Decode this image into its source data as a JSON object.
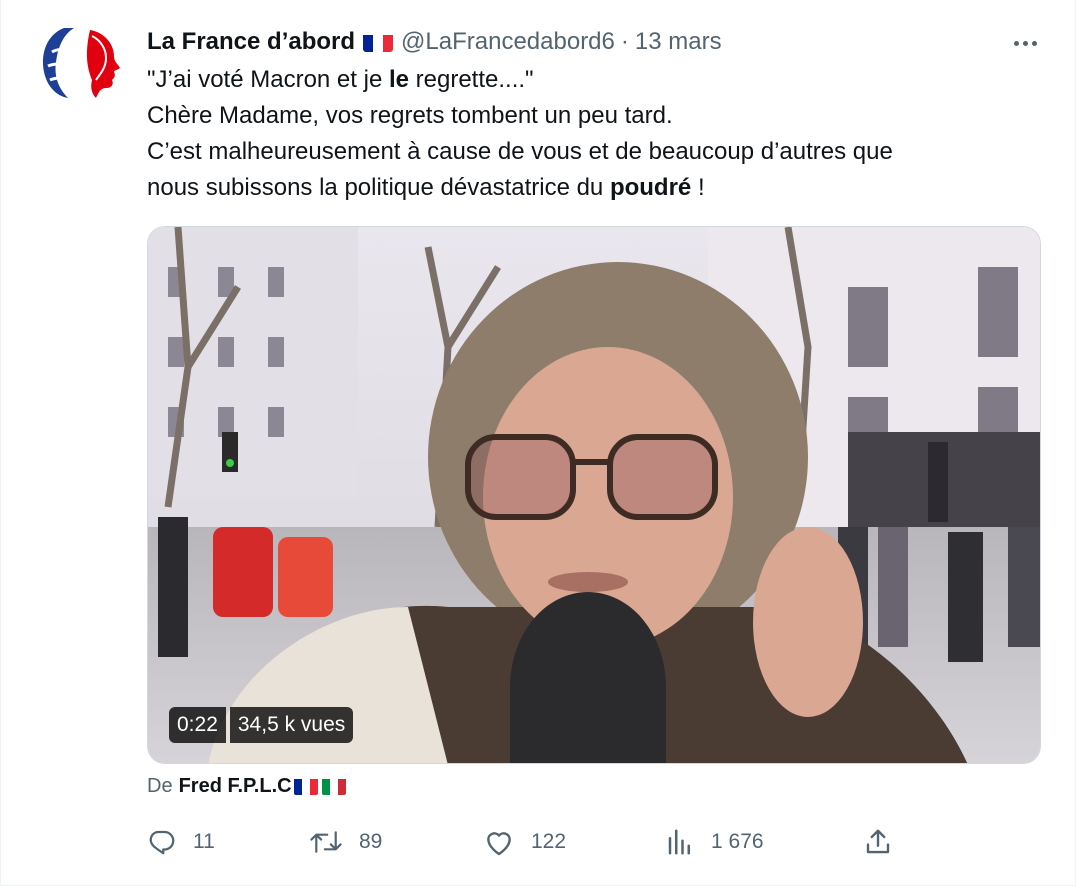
{
  "author": {
    "name": "La France d’abord",
    "handle": "@LaFrancedabord6",
    "separator": "·",
    "date": "13 mars",
    "avatar_icon": "marianne-logo-icon",
    "flag_icon": "french-flag-icon"
  },
  "text": {
    "line1_a": "\"J’ai voté Macron et je ",
    "line1_bold": "le",
    "line1_b": " regrette....\"",
    "line2": "Chère Madame, vos regrets tombent un peu tard.",
    "line3": "C’est malheureusement à cause de vous et de beaucoup d’autres que",
    "line4_a": "nous subissons la politique dévastatrice du ",
    "line4_bold": "poudré",
    "line4_b": " !"
  },
  "video": {
    "duration": "0:22",
    "views": "34,5 k vues"
  },
  "attribution": {
    "prefix": "De",
    "author": "Fred F.P.L.C"
  },
  "actions": {
    "replies": "11",
    "reposts": "89",
    "likes": "122",
    "views": "1 676"
  },
  "colors": {
    "muted": "#536471",
    "text": "#0f1419",
    "flag_blue": "#002395",
    "flag_red": "#ed2939",
    "italy_green": "#009246",
    "italy_red": "#ce2b37"
  }
}
